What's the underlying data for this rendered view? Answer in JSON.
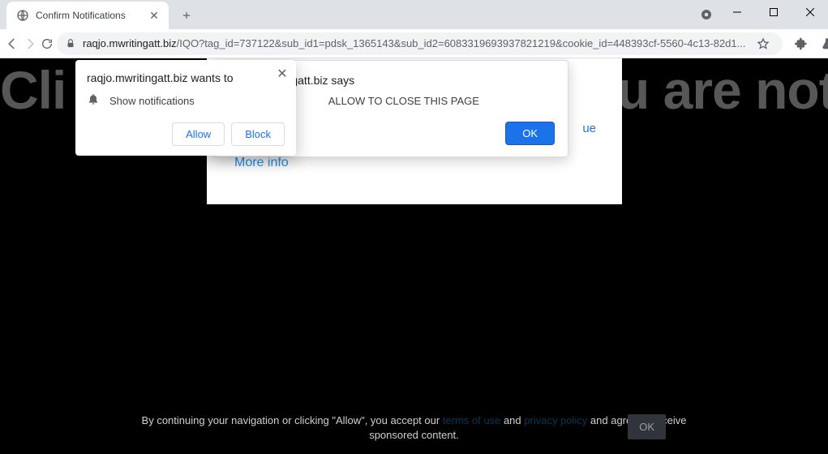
{
  "window": {
    "tab_title": "Confirm Notifications"
  },
  "toolbar": {
    "url_domain": "raqjo.mwritingatt.biz",
    "url_path": "/IQO?tag_id=737122&sub_id1=pdsk_1365143&sub_id2=6083319693937821219&cookie_id=448393cf-5560-4c13-82d1..."
  },
  "page": {
    "background_headline_left": "Cli",
    "background_headline_right": "u are not a",
    "continue_link": "ue",
    "more_info": "More info"
  },
  "alert": {
    "title_visible": "mwritingatt.biz says",
    "body_visible": "ALLOW TO CLOSE THIS PAGE",
    "ok": "OK"
  },
  "perm": {
    "title": "raqjo.mwritingatt.biz wants to",
    "line": "Show notifications",
    "allow": "Allow",
    "block": "Block"
  },
  "cookie": {
    "pre": "By continuing your navigation or clicking \"Allow\", you accept our ",
    "terms": "terms of use",
    "mid": " and ",
    "privacy": "privacy policy",
    "post": " and agree to receive sponsored content.",
    "ok": "OK"
  }
}
